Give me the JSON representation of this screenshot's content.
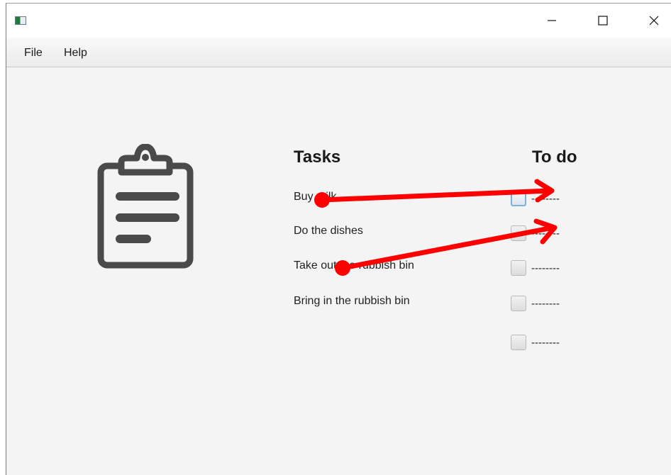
{
  "menu": {
    "items": [
      "File",
      "Help"
    ]
  },
  "window_controls": {
    "minimize_icon": "minimize-icon",
    "maximize_icon": "maximize-icon",
    "close_icon": "close-icon"
  },
  "illustration": {
    "icon": "clipboard-icon",
    "color": "#4a4a4a"
  },
  "tasks": {
    "heading": "Tasks",
    "items": [
      "Buy milk",
      "Do the dishes",
      "Take out the rubbish bin",
      "Bring in the rubbish bin"
    ]
  },
  "todo": {
    "heading": "To do",
    "slots": [
      "--------",
      "--------",
      "--------",
      "--------",
      "--------"
    ]
  },
  "annotation": {
    "color": "#ff0000",
    "description_arrows": 2
  }
}
